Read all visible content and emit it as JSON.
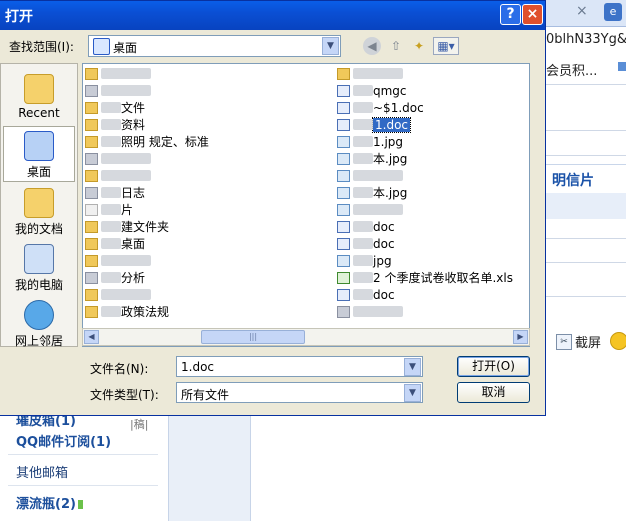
{
  "background": {
    "tab_close": "×",
    "ie_icon": "e",
    "url_fragment": "0blhN33Yg&r",
    "points_link": "会员积...",
    "postcard": "明信片",
    "screenshot": "截屏",
    "sidebar": {
      "draft_fragment": "|稿|",
      "partial_item": "璀皮箱(1)",
      "qq_subscription": "QQ邮件订阅(1)",
      "other_mailbox": "其他邮箱",
      "drift_bottle": "漂流瓶(2)"
    }
  },
  "dialog": {
    "title": "打开",
    "help_button": "?",
    "close_button": "×",
    "lookin_label": "查找范围(I):",
    "lookin_value": "桌面",
    "places": [
      {
        "label": "Recent",
        "icon": "recent-folder-icon"
      },
      {
        "label": "桌面",
        "icon": "desktop-icon"
      },
      {
        "label": "我的文档",
        "icon": "my-documents-icon"
      },
      {
        "label": "我的电脑",
        "icon": "my-computer-icon"
      },
      {
        "label": "网上邻居",
        "icon": "network-places-icon"
      }
    ],
    "files_left": [
      {
        "name": "",
        "type": "folder"
      },
      {
        "name": "",
        "type": "misc"
      },
      {
        "name": "文件",
        "type": "folder"
      },
      {
        "name": "资料",
        "type": "folder"
      },
      {
        "name": "照明        规定、标准",
        "type": "folder"
      },
      {
        "name": "",
        "type": "misc"
      },
      {
        "name": "",
        "type": "folder"
      },
      {
        "name": "日志",
        "type": "misc"
      },
      {
        "name": "片",
        "type": "blank"
      },
      {
        "name": "建文件夹",
        "type": "folder"
      },
      {
        "name": "桌面",
        "type": "folder"
      },
      {
        "name": "",
        "type": "folder"
      },
      {
        "name": "分析",
        "type": "misc"
      },
      {
        "name": "",
        "type": "folder"
      },
      {
        "name": "政策法规",
        "type": "folder"
      }
    ],
    "files_right": [
      {
        "name": "",
        "type": "folder"
      },
      {
        "name": "qmgc",
        "type": "doc"
      },
      {
        "name": "~$1.doc",
        "type": "doc"
      },
      {
        "name": "1.doc",
        "type": "doc",
        "selected": true
      },
      {
        "name": "1.jpg",
        "type": "jpg"
      },
      {
        "name": "本.jpg",
        "type": "jpg"
      },
      {
        "name": "",
        "type": "jpg"
      },
      {
        "name": "本.jpg",
        "type": "jpg"
      },
      {
        "name": "",
        "type": "jpg"
      },
      {
        "name": "doc",
        "type": "doc"
      },
      {
        "name": "doc",
        "type": "doc"
      },
      {
        "name": "jpg",
        "type": "jpg"
      },
      {
        "name": "2     个季度试卷收取名单.xls",
        "type": "xls"
      },
      {
        "name": "doc",
        "type": "doc"
      },
      {
        "name": "",
        "type": "misc"
      }
    ],
    "filename_label": "文件名(N):",
    "filename_value": "1.doc",
    "filetype_label": "文件类型(T):",
    "filetype_value": "所有文件",
    "open_button": "打开(O)",
    "cancel_button": "取消"
  }
}
